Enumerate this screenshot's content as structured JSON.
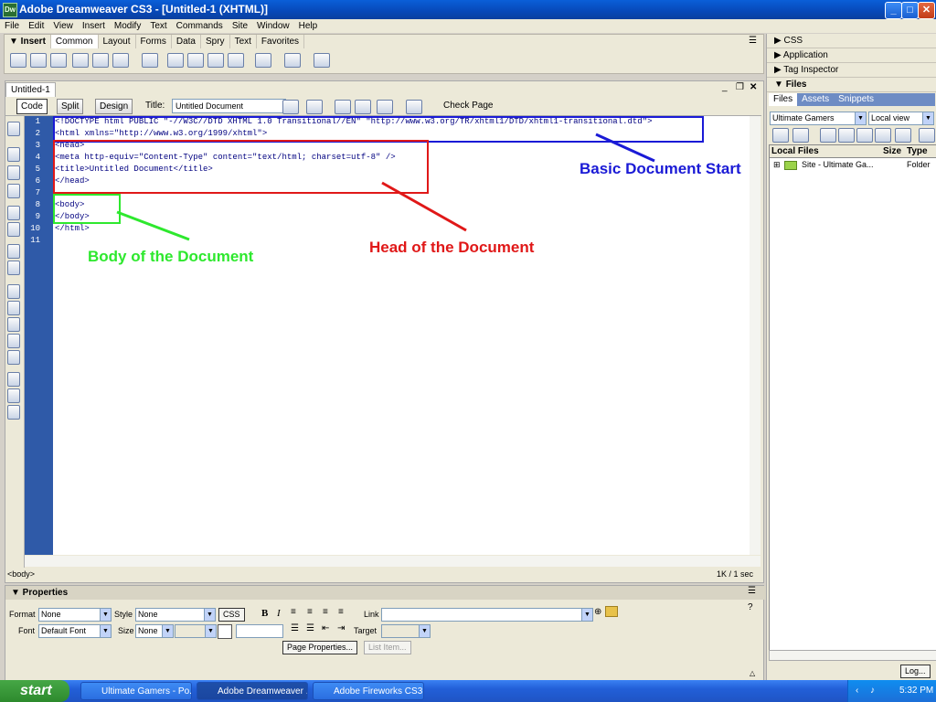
{
  "window": {
    "title": "Adobe Dreamweaver CS3 - [Untitled-1 (XHTML)]",
    "app_icon": "Dw",
    "min": "_",
    "max": "□",
    "close": "✕"
  },
  "menu": [
    "File",
    "Edit",
    "View",
    "Insert",
    "Modify",
    "Text",
    "Commands",
    "Site",
    "Window",
    "Help"
  ],
  "insert_bar": {
    "label": "▼ Insert",
    "tabs": [
      "Common",
      "Layout",
      "Forms",
      "Data",
      "Spry",
      "Text",
      "Favorites"
    ],
    "active_tab": "Common"
  },
  "document": {
    "tab": "Untitled-1",
    "view_buttons": {
      "code": "Code",
      "split": "Split",
      "design": "Design"
    },
    "title_label": "Title:",
    "title_value": "Untitled Document",
    "check_page": "Check Page",
    "line_numbers": [
      "1",
      "2",
      "3",
      "4",
      "5",
      "6",
      "7",
      "8",
      "9",
      "10",
      "11"
    ],
    "code_lines": [
      "<!DOCTYPE html PUBLIC \"-//W3C//DTD XHTML 1.0 Transitional//EN\" \"http://www.w3.org/TR/xhtml1/DTD/xhtml1-transitional.dtd\">",
      "<html xmlns=\"http://www.w3.org/1999/xhtml\">",
      "<head>",
      "<meta http-equiv=\"Content-Type\" content=\"text/html; charset=utf-8\" />",
      "<title>Untitled Document</title>",
      "</head>",
      "",
      "<body>",
      "</body>",
      "</html>",
      ""
    ],
    "status_tag": "<body>",
    "status_size": "1K / 1 sec"
  },
  "annotations": {
    "doc_start": {
      "text": "Basic Document Start",
      "color": "#1a1ad6"
    },
    "head": {
      "text": "Head of the Document",
      "color": "#e01818"
    },
    "body": {
      "text": "Body of the Document",
      "color": "#2ee82e"
    }
  },
  "properties": {
    "header": "▼ Properties",
    "format_label": "Format",
    "format_value": "None",
    "style_label": "Style",
    "style_value": "None",
    "css_button": "CSS",
    "bold": "B",
    "italic": "I",
    "link_label": "Link",
    "link_value": "",
    "font_label": "Font",
    "font_value": "Default Font",
    "size_label": "Size",
    "size_value": "None",
    "target_label": "Target",
    "page_properties": "Page Properties...",
    "list_item": "List Item..."
  },
  "right_panel": {
    "css": "CSS",
    "application": "Application",
    "tag_inspector": "Tag Inspector",
    "files": "Files",
    "files_tabs": [
      "Files",
      "Assets",
      "Snippets"
    ],
    "site_select": "Ultimate Gamers",
    "view_select": "Local view",
    "columns": {
      "name": "Local Files",
      "size": "Size",
      "type": "Type"
    },
    "rows": [
      {
        "name": "Site - Ultimate Ga...",
        "type": "Folder"
      }
    ],
    "log_button": "Log..."
  },
  "taskbar": {
    "start": "start",
    "items": [
      "Ultimate Gamers - Po...",
      "Adobe Dreamweaver ...",
      "Adobe Fireworks CS3..."
    ],
    "active_index": 1,
    "clock": "5:32 PM"
  }
}
